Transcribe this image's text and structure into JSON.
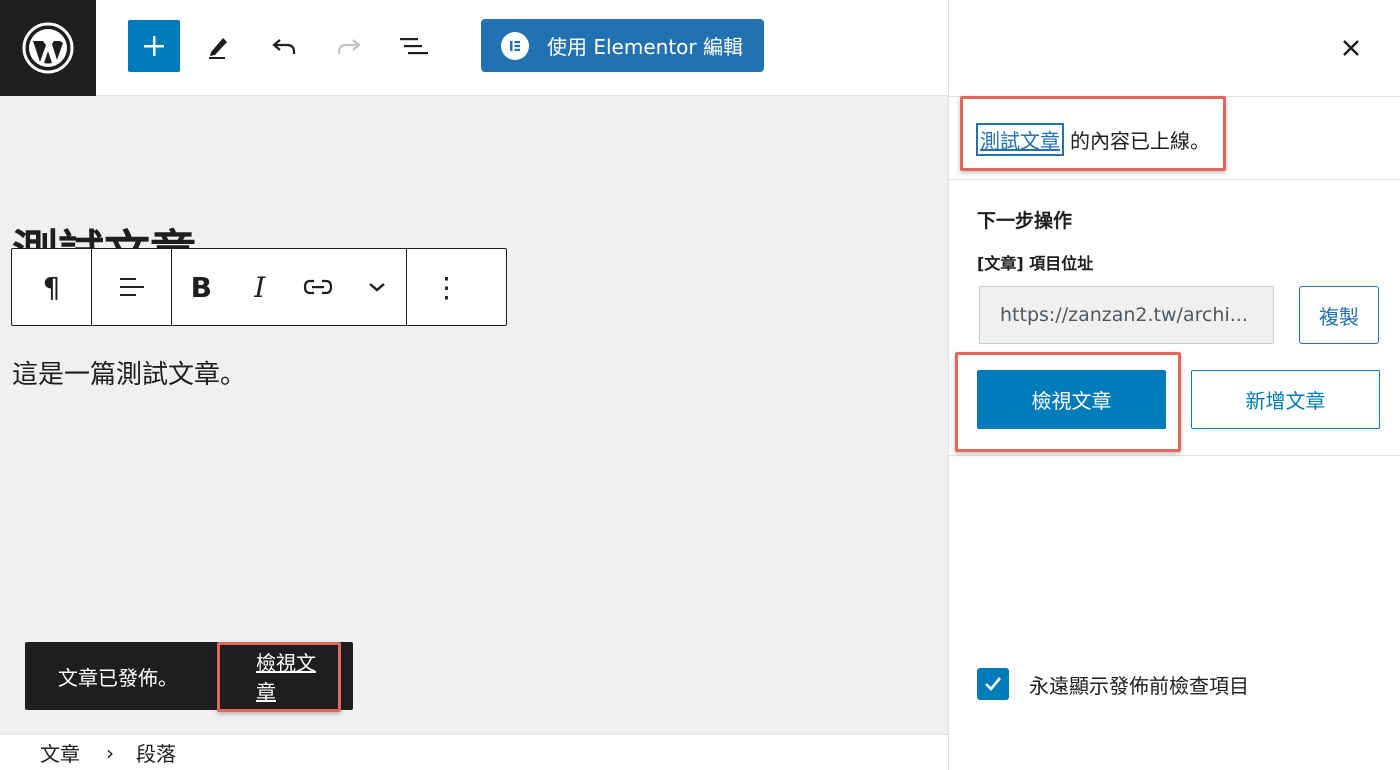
{
  "toolbar": {
    "add_label": "+",
    "elementor_button": "使用 Elementor 編輯"
  },
  "editor": {
    "post_title": "測試文章",
    "paragraph": "這是一篇測試文章。",
    "block_toolbar": {
      "paragraph_symbol": "¶",
      "bold": "B",
      "italic": "I",
      "more": "⋮"
    }
  },
  "snackbar": {
    "message": "文章已發佈。",
    "view_link": "檢視文章"
  },
  "breadcrumb": {
    "items": [
      "文章",
      "段落"
    ],
    "separator": "›"
  },
  "sidebar": {
    "close_symbol": "✕",
    "published": {
      "post_link": "測試文章",
      "suffix": "的內容已上線。"
    },
    "next_steps_title": "下一步操作",
    "url_label": "[文章] 項目位址",
    "url_value": "https://zanzan2.tw/archi...",
    "copy_button": "複製",
    "view_post_button": "檢視文章",
    "new_post_button": "新增文章",
    "always_show_label": "永遠顯示發佈前檢查項目",
    "always_show_checked": true
  },
  "colors": {
    "accent": "#007cba",
    "elementor": "#2271b1",
    "dark": "#1e1e1e",
    "canvas": "#f0f0f0",
    "highlight": "#e0685f"
  }
}
